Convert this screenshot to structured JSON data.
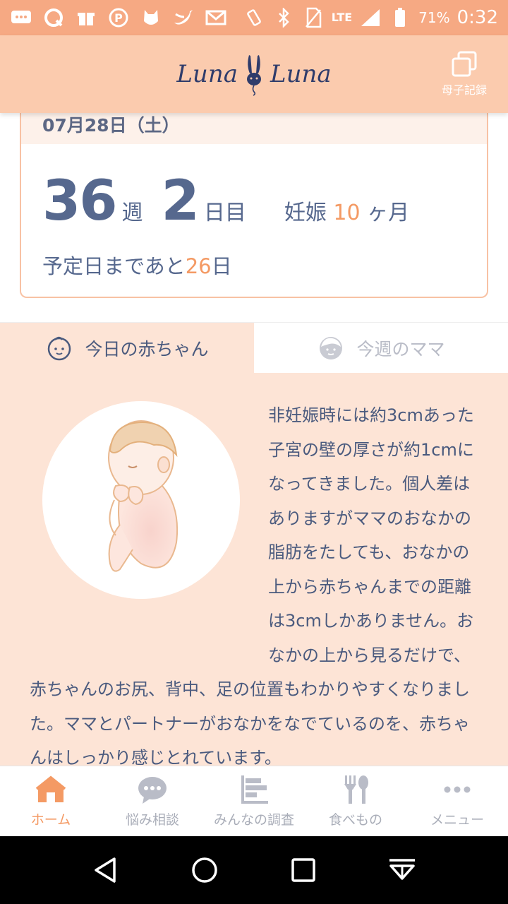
{
  "status_bar": {
    "network": "LTE",
    "battery_percent": "71%",
    "time": "0:32",
    "icons": [
      "chat-icon",
      "q-icon",
      "gift-icon",
      "parking-icon",
      "cat-icon",
      "twitter-icon",
      "mail-icon",
      "vibrate-icon",
      "bluetooth-icon",
      "no-sim-icon",
      "signal-icon",
      "battery-icon"
    ]
  },
  "header": {
    "logo_left": "Luna",
    "logo_right": "Luna",
    "boshi_label": "母子記録"
  },
  "card": {
    "date": "07月28日（土）",
    "weeks": "36",
    "weeks_unit": "週",
    "days": "2",
    "days_unit": "日目",
    "pregnancy_prefix": "妊娠",
    "pregnancy_month": "10",
    "pregnancy_suffix": "ヶ月",
    "due_prefix": "予定日まであと",
    "due_days": "26",
    "due_suffix": "日"
  },
  "tabs": [
    {
      "label": "今日の赤ちゃん",
      "active": true
    },
    {
      "label": "今週のママ",
      "active": false
    }
  ],
  "article": {
    "text": "非妊娠時には約3cmあった子宮の壁の厚さが約1cmになってきました。個人差はありますがママのおなかの脂肪をたしても、おなかの上から赤ちゃんまでの距離は3cmしかありません。おなかの上から見るだけで、赤ちゃんのお尻、背中、足の位置もわかりやすくなりました。ママとパートナーがおなかをなでているのを、赤ちゃんはしっかり感じとれています。"
  },
  "bottom_nav": [
    {
      "label": "ホーム",
      "icon": "home-icon",
      "active": true
    },
    {
      "label": "悩み相談",
      "icon": "chat-bubble-icon",
      "active": false
    },
    {
      "label": "みんなの調査",
      "icon": "bar-chart-icon",
      "active": false
    },
    {
      "label": "食べもの",
      "icon": "fork-spoon-icon",
      "active": false
    },
    {
      "label": "メニュー",
      "icon": "more-dots-icon",
      "active": false
    }
  ],
  "colors": {
    "status_bar": "#f6a983",
    "header": "#fbcbae",
    "accent": "#f49a64",
    "text": "#56688e",
    "content_bg": "#fde4d6"
  }
}
